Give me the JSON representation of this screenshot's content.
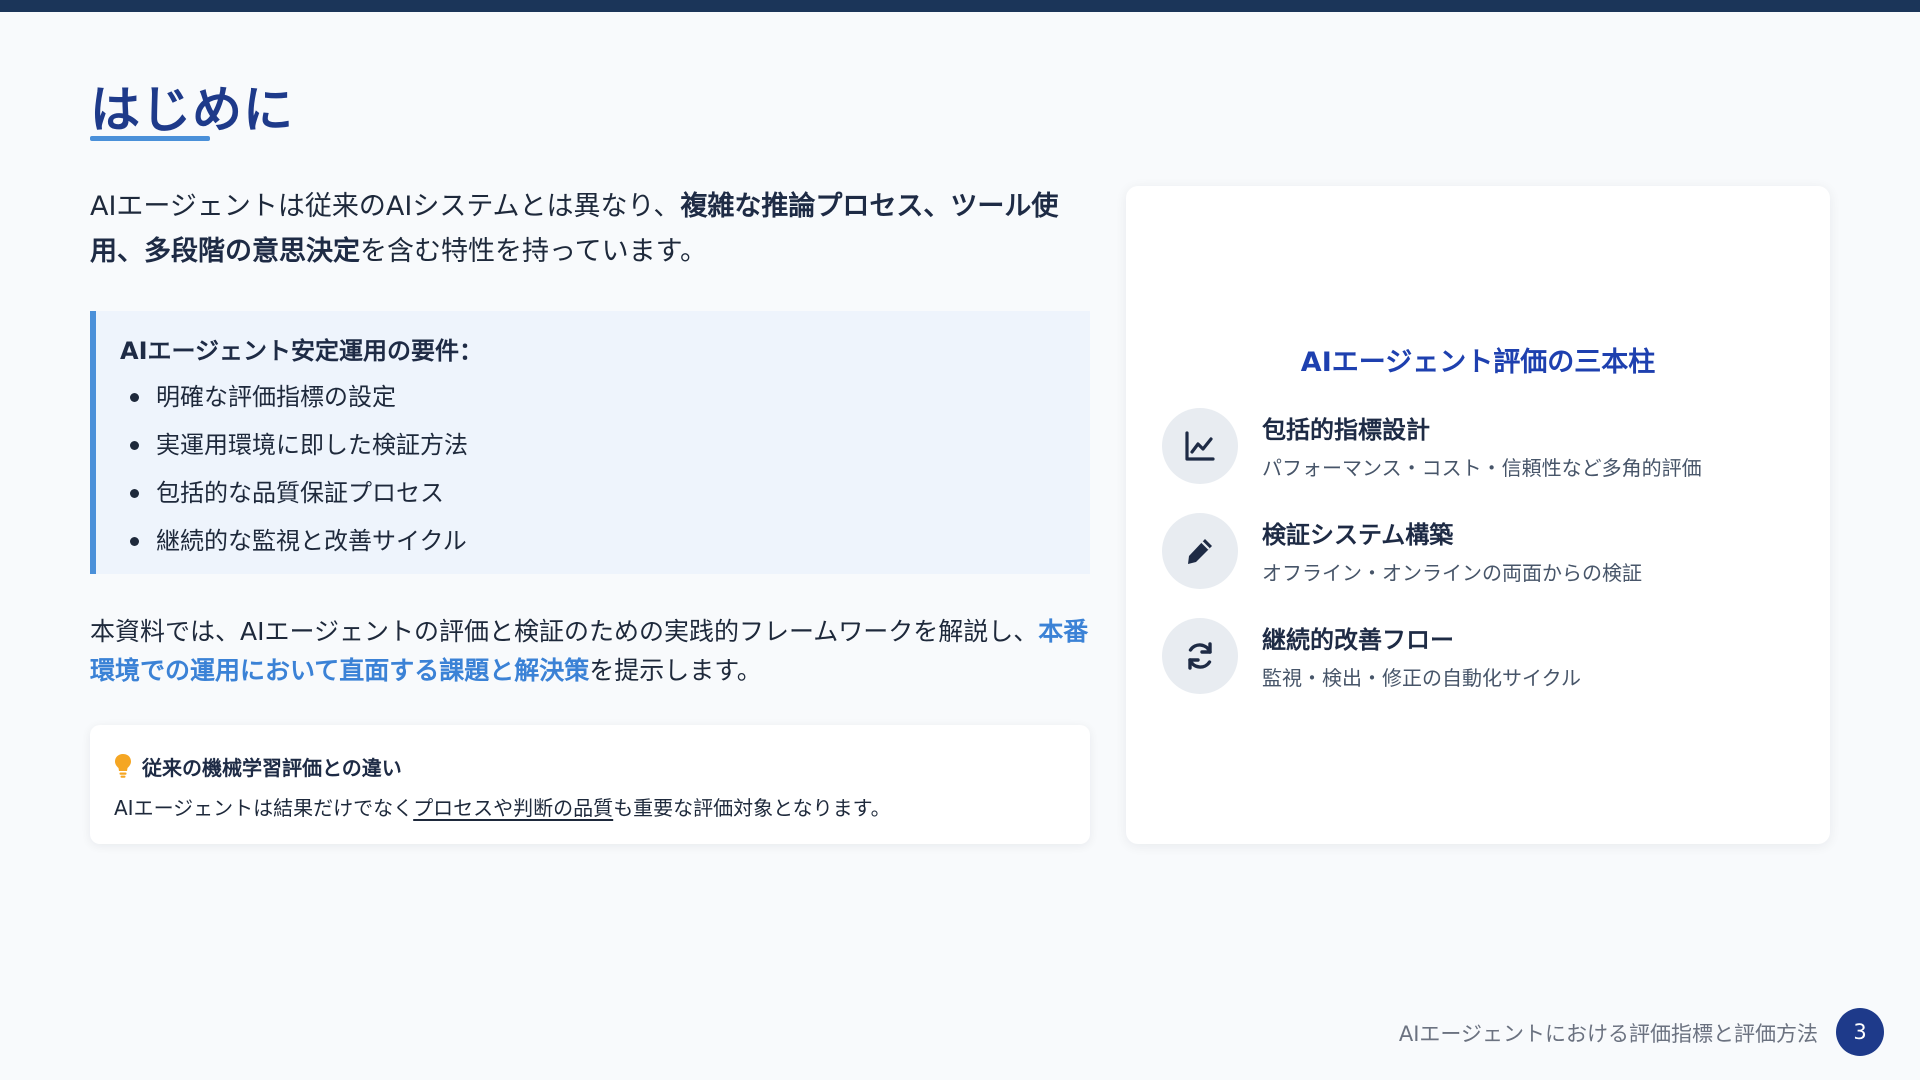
{
  "slide": {
    "title": "はじめに",
    "intro": {
      "text1": "AIエージェントは従来のAIシステムとは異なり、",
      "bold": "複雑な推論プロセス、ツール使用、多段階の意思決定",
      "text2": "を含む特性を持っています。"
    },
    "requirements": {
      "heading": "AIエージェント安定運用の要件：",
      "items": [
        "明確な評価指標の設定",
        "実運用環境に即した検証方法",
        "包括的な品質保証プロセス",
        "継続的な監視と改善サイクル"
      ]
    },
    "summary": {
      "text1": "本資料では、AIエージェントの評価と検証のための実践的フレームワークを解説し、",
      "highlight": "本番環境での運用において直面する課題と解決策",
      "text2": "を提示します。"
    },
    "note": {
      "icon": "lightbulb-icon",
      "title": "従来の機械学習評価との違い",
      "text1": "AIエージェントは結果だけでなく",
      "underline": "プロセスや判断の品質",
      "text2": "も重要な評価対象となります。"
    },
    "pillars": {
      "title": "AIエージェント評価の三本柱",
      "items": [
        {
          "icon": "line-chart-icon",
          "name": "包括的指標設計",
          "desc": "パフォーマンス・コスト・信頼性など多角的評価"
        },
        {
          "icon": "pencil-icon",
          "name": "検証システム構築",
          "desc": "オフライン・オンラインの両面からの検証"
        },
        {
          "icon": "refresh-icon",
          "name": "継続的改善フロー",
          "desc": "監視・検出・修正の自動化サイクル"
        }
      ]
    },
    "footer": {
      "deck_title": "AIエージェントにおける評価指標と評価方法",
      "page_number": "3"
    }
  },
  "colors": {
    "top_bar": "#1b3559",
    "title": "#1e3a8a",
    "accent": "#4a90d9",
    "highlight": "#3b82d6",
    "pillars_title": "#1e40af",
    "bulb": "#f5a623"
  }
}
